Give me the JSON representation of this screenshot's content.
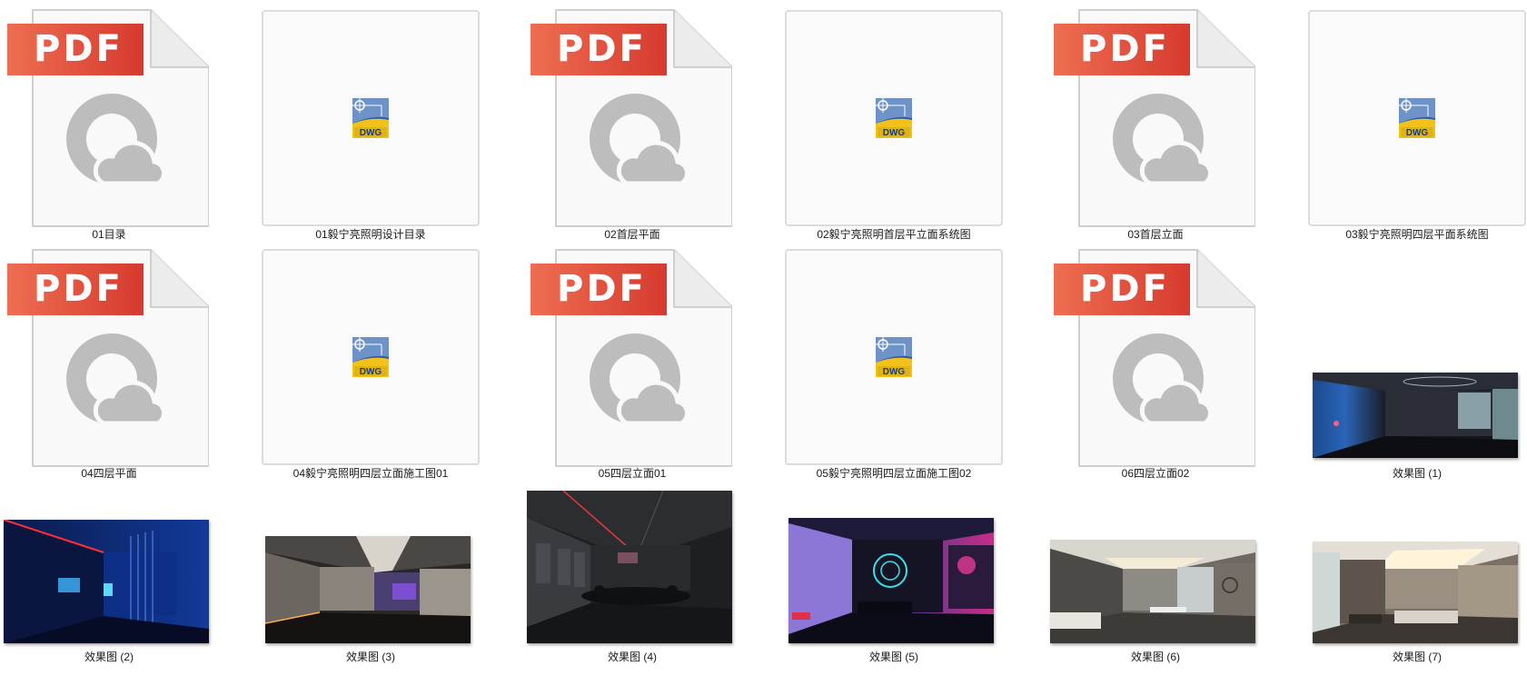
{
  "files": [
    {
      "name": "01目录",
      "type": "pdf"
    },
    {
      "name": "01毅宁亮照明设计目录",
      "type": "dwg"
    },
    {
      "name": "02首层平面",
      "type": "pdf"
    },
    {
      "name": "02毅宁亮照明首层平立面系统图",
      "type": "dwg"
    },
    {
      "name": "03首层立面",
      "type": "pdf"
    },
    {
      "name": "03毅宁亮照明四层平面系统图",
      "type": "dwg"
    },
    {
      "name": "04四层平面",
      "type": "pdf"
    },
    {
      "name": "04毅宁亮照明四层立面施工图01",
      "type": "dwg"
    },
    {
      "name": "05四层立面01",
      "type": "pdf"
    },
    {
      "name": "05毅宁亮照明四层立面施工图02",
      "type": "dwg"
    },
    {
      "name": "06四层立面02",
      "type": "pdf"
    },
    {
      "name": "效果图 (1)",
      "type": "image"
    },
    {
      "name": "效果图 (2)",
      "type": "image"
    },
    {
      "name": "效果图 (3)",
      "type": "image"
    },
    {
      "name": "效果图 (4)",
      "type": "image"
    },
    {
      "name": "效果图 (5)",
      "type": "image"
    },
    {
      "name": "效果图 (6)",
      "type": "image"
    },
    {
      "name": "效果图 (7)",
      "type": "image"
    }
  ],
  "badges": {
    "pdf": "PDF",
    "dwg": "DWG"
  },
  "colors": {
    "pdf_badge_start": "#ee6d51",
    "pdf_badge_end": "#d63a2e",
    "dwg_blue": "#2b5aa8",
    "dwg_yellow": "#f2c21b"
  }
}
